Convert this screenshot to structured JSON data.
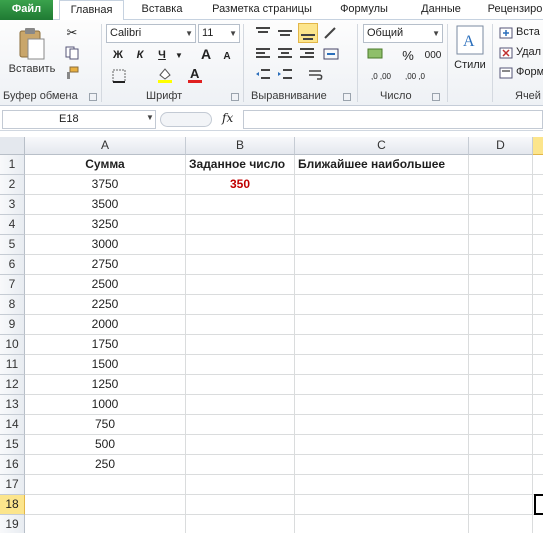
{
  "tabs": [
    {
      "label": "Файл"
    },
    {
      "label": "Главная"
    },
    {
      "label": "Вставка"
    },
    {
      "label": "Разметка страницы"
    },
    {
      "label": "Формулы"
    },
    {
      "label": "Данные"
    },
    {
      "label": "Рецензиро"
    }
  ],
  "ribbon": {
    "clipboard": {
      "paste_label": "Вставить",
      "group_label": "Буфер обмена"
    },
    "font": {
      "font_name": "Calibri",
      "font_size": "11",
      "bold": "Ж",
      "italic": "К",
      "underline": "Ч",
      "grow": "A",
      "shrink": "A",
      "group_label": "Шрифт"
    },
    "alignment": {
      "group_label": "Выравнивание"
    },
    "number": {
      "format": "Общий",
      "percent": "%",
      "thousands": "000",
      "inc_decimal": ",0 ,00",
      "dec_decimal": ",00 ,0",
      "group_label": "Число"
    },
    "styles": {
      "label": "Стили"
    },
    "cells": {
      "insert": "Вста",
      "delete": "Удал",
      "format": "Форм",
      "group_label": "Ячей"
    }
  },
  "formula_bar": {
    "name_box": "E18",
    "fx": "fx",
    "value": ""
  },
  "columns": [
    "A",
    "B",
    "C",
    "D"
  ],
  "rows": [
    {
      "n": "1",
      "a": "Сумма",
      "b": "Заданное число",
      "c": "Ближайшее наибольшее"
    },
    {
      "n": "2",
      "a": "3750",
      "b": "350",
      "c": ""
    },
    {
      "n": "3",
      "a": "3500",
      "b": "",
      "c": ""
    },
    {
      "n": "4",
      "a": "3250",
      "b": "",
      "c": ""
    },
    {
      "n": "5",
      "a": "3000",
      "b": "",
      "c": ""
    },
    {
      "n": "6",
      "a": "2750",
      "b": "",
      "c": ""
    },
    {
      "n": "7",
      "a": "2500",
      "b": "",
      "c": ""
    },
    {
      "n": "8",
      "a": "2250",
      "b": "",
      "c": ""
    },
    {
      "n": "9",
      "a": "2000",
      "b": "",
      "c": ""
    },
    {
      "n": "10",
      "a": "1750",
      "b": "",
      "c": ""
    },
    {
      "n": "11",
      "a": "1500",
      "b": "",
      "c": ""
    },
    {
      "n": "12",
      "a": "1250",
      "b": "",
      "c": ""
    },
    {
      "n": "13",
      "a": "1000",
      "b": "",
      "c": ""
    },
    {
      "n": "14",
      "a": "750",
      "b": "",
      "c": ""
    },
    {
      "n": "15",
      "a": "500",
      "b": "",
      "c": ""
    },
    {
      "n": "16",
      "a": "250",
      "b": "",
      "c": ""
    },
    {
      "n": "17",
      "a": "",
      "b": "",
      "c": ""
    },
    {
      "n": "18",
      "a": "",
      "b": "",
      "c": ""
    },
    {
      "n": "19",
      "a": "",
      "b": "",
      "c": ""
    }
  ],
  "selected_row": "18",
  "colors": {
    "file_tab": "#2b8a3e",
    "value_red": "#c00000",
    "selected_header": "#fce58c"
  }
}
